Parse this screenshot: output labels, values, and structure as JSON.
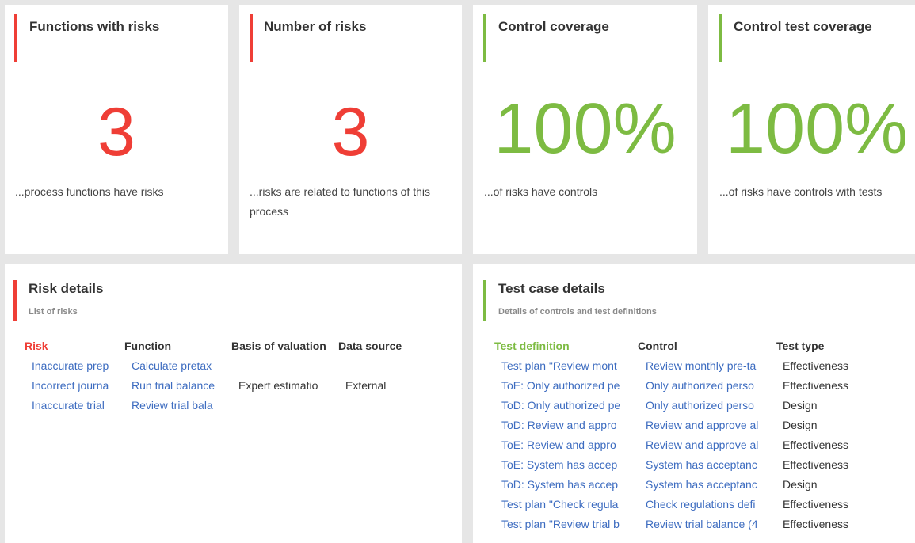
{
  "kpis": [
    {
      "title": "Functions with risks",
      "value": "3",
      "description": "...process functions have risks",
      "color": "#ef3e36"
    },
    {
      "title": "Number of risks",
      "value": "3",
      "description": "...risks are related to functions of this process",
      "color": "#ef3e36"
    },
    {
      "title": "Control coverage",
      "value": "100%",
      "description": "...of risks have controls",
      "color": "#7dbb42"
    },
    {
      "title": "Control test coverage",
      "value": "100%",
      "description": "...of risks have controls with tests",
      "color": "#7dbb42"
    }
  ],
  "risk_details": {
    "title": "Risk details",
    "subtitle": "List of risks",
    "columns": [
      "Risk",
      "Function",
      "Basis of valuation",
      "Data source"
    ],
    "rows": [
      {
        "risk": "Inaccurate prep",
        "function": "Calculate pretax",
        "basis": "",
        "source": ""
      },
      {
        "risk": "Incorrect journa",
        "function": "Run trial balance",
        "basis": "Expert estimatio",
        "source": "External"
      },
      {
        "risk": "Inaccurate trial",
        "function": "Review trial bala",
        "basis": "",
        "source": ""
      }
    ]
  },
  "test_case_details": {
    "title": "Test case details",
    "subtitle": "Details of controls and test definitions",
    "columns": [
      "Test definition",
      "Control",
      "Test type"
    ],
    "rows": [
      {
        "definition": "Test plan \"Review mont",
        "control": "Review monthly pre-ta",
        "type": "Effectiveness"
      },
      {
        "definition": "ToE: Only authorized pe",
        "control": "Only authorized perso",
        "type": "Effectiveness"
      },
      {
        "definition": "ToD: Only authorized pe",
        "control": "Only authorized perso",
        "type": "Design"
      },
      {
        "definition": "ToD: Review and appro",
        "control": "Review and approve al",
        "type": "Design"
      },
      {
        "definition": "ToE: Review and appro",
        "control": "Review and approve al",
        "type": "Effectiveness"
      },
      {
        "definition": "ToE: System has accep",
        "control": "System has acceptanc",
        "type": "Effectiveness"
      },
      {
        "definition": "ToD: System has accep",
        "control": "System has acceptanc",
        "type": "Design"
      },
      {
        "definition": "Test plan \"Check regula",
        "control": "Check regulations defi",
        "type": "Effectiveness"
      },
      {
        "definition": "Test plan \"Review trial b",
        "control": "Review trial balance (4",
        "type": "Effectiveness"
      }
    ]
  },
  "colors": {
    "red": "#ef3e36",
    "green": "#7dbb42",
    "link": "#3d6cc0"
  }
}
